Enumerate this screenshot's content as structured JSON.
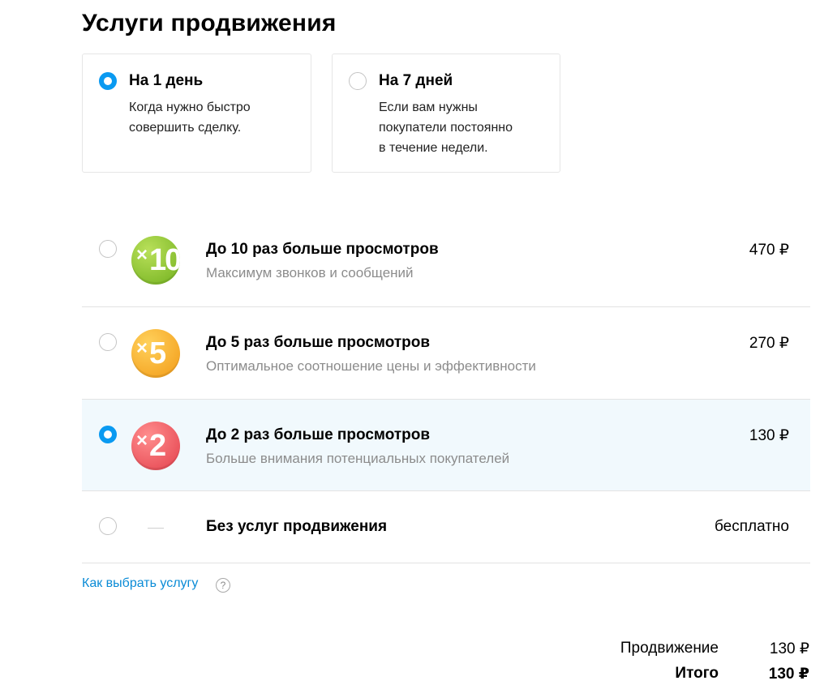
{
  "page": {
    "title": "Услуги продвижения"
  },
  "duration_options": [
    {
      "label": "На 1 день",
      "description_lines": [
        "Когда нужно быстро",
        "совершить сделку."
      ],
      "selected": true
    },
    {
      "label": "На 7 дней",
      "description_lines": [
        "Если вам нужны",
        "покупатели постоянно",
        "в течение недели."
      ],
      "selected": false
    }
  ],
  "promotion_options": [
    {
      "badge_multiplier": "×",
      "badge_value": "10",
      "badge_color": "#7cbc22",
      "title": "До 10 раз больше просмотров",
      "subtitle": "Максимум звонков и сообщений",
      "price": "470 ₽",
      "selected": false
    },
    {
      "badge_multiplier": "×",
      "badge_value": "5",
      "badge_color": "#f5a623",
      "title": "До 5 раз больше просмотров",
      "subtitle": "Оптимальное соотношение цены и эффективности",
      "price": "270 ₽",
      "selected": false
    },
    {
      "badge_multiplier": "×",
      "badge_value": "2",
      "badge_color": "#ea4c55",
      "title": "До 2 раз больше просмотров",
      "subtitle": "Больше внимания потенциальных покупателей",
      "price": "130 ₽",
      "selected": true
    },
    {
      "title": "Без услуг продвижения",
      "price": "бесплатно",
      "selected": false
    }
  ],
  "help": {
    "link_text": "Как выбрать услугу",
    "icon": "question-circle-icon",
    "icon_glyph": "?"
  },
  "summary": {
    "promotion_label": "Продвижение",
    "promotion_value": "130 ₽",
    "total_label": "Итого",
    "total_value": "130 ₽"
  },
  "colors": {
    "accent": "#0a9af1",
    "link": "#0a8bd6",
    "selected_row_bg": "#f1f9fd"
  }
}
